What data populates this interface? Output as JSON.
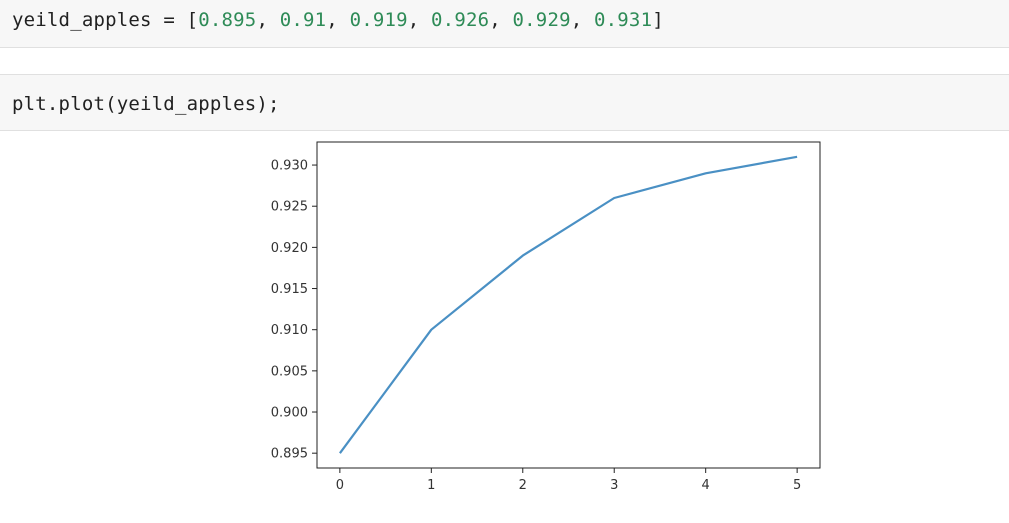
{
  "cells": [
    {
      "variable": "yeild_apples",
      "operator": "=",
      "open_bracket": "[",
      "close_bracket": "]",
      "separator": ", ",
      "values": [
        "0.895",
        "0.91",
        "0.919",
        "0.926",
        "0.929",
        "0.931"
      ]
    },
    {
      "code": "plt.plot(yeild_apples);"
    }
  ],
  "chart_data": {
    "type": "line",
    "x": [
      0,
      1,
      2,
      3,
      4,
      5
    ],
    "series": [
      {
        "values": [
          0.895,
          0.91,
          0.919,
          0.926,
          0.929,
          0.931
        ],
        "color": "#4a90c4"
      }
    ],
    "xticks": [
      "0",
      "1",
      "2",
      "3",
      "4",
      "5"
    ],
    "yticks": [
      "0.895",
      "0.900",
      "0.905",
      "0.910",
      "0.915",
      "0.920",
      "0.925",
      "0.930"
    ],
    "ylim": [
      0.8932,
      0.9328
    ],
    "xlim": [
      -0.25,
      5.25
    ],
    "grid": false
  }
}
